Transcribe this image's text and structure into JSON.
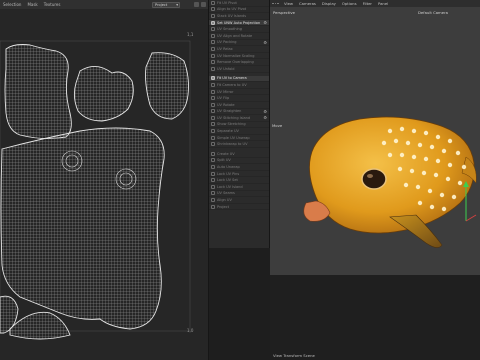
{
  "uv_editor": {
    "menu": [
      "Selection",
      "Mask",
      "Textures"
    ],
    "mode_select": "Project",
    "corner_top_right": "1,1",
    "corner_bottom_right": "1,0"
  },
  "tool_panel": {
    "items": [
      {
        "label": "Fit UV Pivot",
        "active": false
      },
      {
        "label": "Align to UV Pivot",
        "active": false
      },
      {
        "label": "Stack UV Islands",
        "active": false
      },
      {
        "label": "Set UNW Auto Projection",
        "active": true,
        "gear": true
      },
      {
        "label": "UV Smoothing",
        "active": false
      },
      {
        "label": "UV Align and Rotate",
        "active": false
      },
      {
        "label": "UV Packing",
        "active": false,
        "gear": true
      },
      {
        "label": "UV Relax",
        "active": false
      },
      {
        "label": "UV Normalize Scaling",
        "active": false
      },
      {
        "label": "Remove Overlapping",
        "active": false
      },
      {
        "label": "UV Unfold",
        "active": false
      },
      {
        "label": "Fit UV to Camera",
        "active": true
      },
      {
        "label": "Fit Camera to UV",
        "active": false
      },
      {
        "label": "UV Mirror",
        "active": false
      },
      {
        "label": "UV Flip",
        "active": false
      },
      {
        "label": "UV Rotate",
        "active": false
      },
      {
        "label": "UV Straighten",
        "active": false,
        "gear": true
      },
      {
        "label": "UV Stitching Island",
        "active": false,
        "gear": true
      },
      {
        "label": "Show Stretching",
        "active": false
      },
      {
        "label": "Separate UV",
        "active": false
      },
      {
        "label": "Simple UV Unwrap",
        "active": false
      },
      {
        "label": "Shrinkwrap to UV",
        "active": false
      },
      {
        "label": "Create UV",
        "active": false
      },
      {
        "label": "Split UV",
        "active": false
      },
      {
        "label": "Auto Unwrap",
        "active": false
      },
      {
        "label": "Lock UV Pins",
        "active": false
      },
      {
        "label": "Lock UV Set",
        "active": false
      },
      {
        "label": "Lock UV Island",
        "active": false
      },
      {
        "label": "UV Seams",
        "active": false
      },
      {
        "label": "Align UV",
        "active": false
      },
      {
        "label": "Project",
        "active": false
      }
    ]
  },
  "viewport": {
    "menu": [
      "View",
      "Cameras",
      "Display",
      "Options",
      "Filter",
      "Panel"
    ],
    "view_name": "Perspective",
    "camera_name": "Default Camera",
    "side_label": "Move",
    "bottom_label": "View Transform Scene"
  },
  "colors": {
    "accent": "#1a8fd6",
    "fish_body": "#e09a1c",
    "wireframe": "#bdbdbd"
  }
}
